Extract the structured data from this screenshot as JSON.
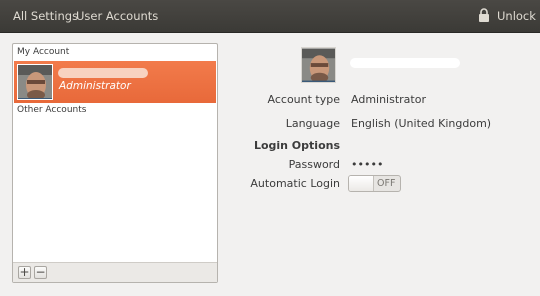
{
  "header": {
    "nav_all_settings": "All Settings",
    "nav_current": "User Accounts",
    "unlock_label": "Unlock",
    "lock_icon": "lock-icon"
  },
  "sidebar": {
    "my_account_header": "My Account",
    "selected_account_role": "Administrator",
    "other_accounts_header": "Other Accounts",
    "add_label": "+",
    "remove_label": "−"
  },
  "details": {
    "account_type_label": "Account type",
    "account_type_value": "Administrator",
    "language_label": "Language",
    "language_value": "English (United Kingdom)",
    "login_options_heading": "Login Options",
    "password_label": "Password",
    "password_value": "•••••",
    "automatic_login_label": "Automatic Login",
    "automatic_login_state": "OFF"
  },
  "colors": {
    "selection": "#e8693a",
    "titlebar": "#3b3a36",
    "background": "#f2f1f0"
  }
}
